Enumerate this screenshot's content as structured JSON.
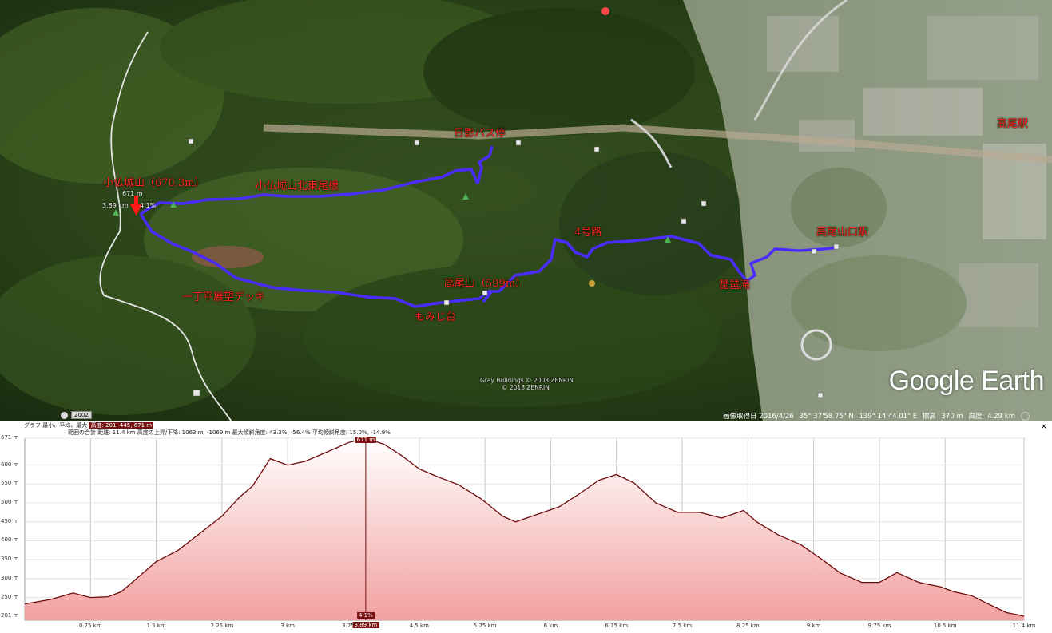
{
  "map": {
    "labels": {
      "kobotoke_summit": "小仏城山（670.3m）",
      "kobotoke_ridge": "小仏城山北東尾根",
      "bus_stop": "日影バス停",
      "takao_station": "高尾駅",
      "takaosanguchi_station": "高尾山口駅",
      "route4": "4号路",
      "takaosan": "高尾山（599m）",
      "biwa_falls": "琵琶滝",
      "icchodaira": "一丁平展望デッキ",
      "momijidai": "もみじ台"
    },
    "cursor_readout": {
      "elevation": "671 m",
      "distance": "3.89 km",
      "grade": "4.1%"
    },
    "credits": [
      "Gray Buildings © 2008 ZENRIN",
      "© 2018 ZENRIN"
    ],
    "logo": "Google Earth",
    "year_badge": "2002",
    "status": {
      "imagery_date": "画像取得日 2016/4/26",
      "lat": "35° 37'58.75\" N",
      "lon": "139° 14'44.01\" E",
      "elev_label": "標高",
      "elev_value": "370 m",
      "eye_label": "高度",
      "eye_value": "4.29 km"
    },
    "route_color": "#4a2cff"
  },
  "graph": {
    "header_row1_prefix": "グラフ 最小、平均、最大",
    "header_row1_value": "高度: 201, 445, 671 m",
    "header_row2": "範囲の合計  距離: 11.4 km  高度の上昇/下降: 1063 m, -1069 m  最大傾斜角度: 43.3%, -56.4%  平均傾斜角度: 15.0%, -14.9%",
    "close": "×",
    "marker_top": "671 m",
    "marker_bottom_grade": "4.1%",
    "marker_bottom_dist": "3.89 km"
  },
  "chart_data": {
    "type": "area",
    "xlabel": "",
    "ylabel": "",
    "xlim": [
      0,
      11.4
    ],
    "ylim": [
      190,
      671
    ],
    "x_ticks": [
      "0.75 km",
      "1.5 km",
      "2.25 km",
      "3 km",
      "3.75 km",
      "4.5 km",
      "5.25 km",
      "6 km",
      "6.75 km",
      "7.5 km",
      "8.25 km",
      "9 km",
      "9.75 km",
      "10.5 km",
      "11.4 km"
    ],
    "x_tick_values": [
      0.75,
      1.5,
      2.25,
      3,
      3.75,
      4.5,
      5.25,
      6,
      6.75,
      7.5,
      8.25,
      9,
      9.75,
      10.5,
      11.4
    ],
    "y_ticks": [
      "201 m",
      "250 m",
      "300 m",
      "350 m",
      "400 m",
      "450 m",
      "500 m",
      "550 m",
      "600 m",
      "671 m"
    ],
    "y_tick_values": [
      201,
      250,
      300,
      350,
      400,
      450,
      500,
      550,
      600,
      671
    ],
    "x": [
      0,
      0.3,
      0.55,
      0.75,
      0.95,
      1.1,
      1.3,
      1.5,
      1.75,
      2.0,
      2.25,
      2.45,
      2.6,
      2.8,
      3.0,
      3.2,
      3.45,
      3.7,
      3.89,
      4.1,
      4.3,
      4.5,
      4.7,
      4.95,
      5.2,
      5.45,
      5.6,
      5.85,
      6.1,
      6.3,
      6.55,
      6.75,
      6.95,
      7.2,
      7.45,
      7.7,
      7.95,
      8.2,
      8.35,
      8.6,
      8.85,
      9.1,
      9.3,
      9.55,
      9.75,
      9.95,
      10.2,
      10.45,
      10.6,
      10.8,
      11.0,
      11.2,
      11.4
    ],
    "y": [
      233,
      245,
      262,
      250,
      252,
      265,
      305,
      345,
      375,
      420,
      465,
      515,
      545,
      617,
      600,
      610,
      635,
      660,
      671,
      655,
      625,
      590,
      570,
      548,
      512,
      465,
      450,
      470,
      490,
      520,
      560,
      575,
      553,
      500,
      475,
      475,
      460,
      480,
      450,
      415,
      390,
      350,
      315,
      290,
      290,
      316,
      290,
      278,
      265,
      255,
      232,
      210,
      201
    ],
    "marker": {
      "x": 3.89,
      "y": 671,
      "grade": "4.1%"
    },
    "fill_top_color": "#ffffff",
    "fill_bottom_color": "#f2a0a0",
    "line_color": "#6e0a0a"
  }
}
